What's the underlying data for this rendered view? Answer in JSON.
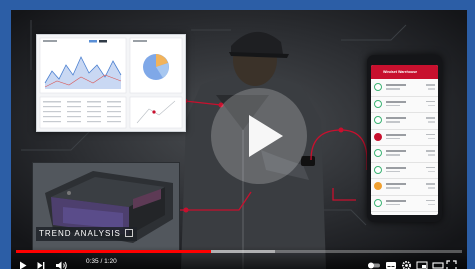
{
  "video": {
    "overlay_label": "TREND ANALYSIS",
    "phone_header": "Windset Warehouse",
    "time_current": "0:35",
    "time_separator": " / ",
    "time_total": "1:20",
    "played_fraction": 0.437,
    "loaded_fraction": 0.58
  },
  "colors": {
    "frame_bg": "#2c5ea6",
    "accent_red": "#c8102e",
    "progress_red": "#ff0000"
  },
  "controls": {
    "play": "play-icon",
    "next": "next-icon",
    "volume": "volume-icon",
    "autoplay": "autoplay-toggle-icon",
    "subtitles": "subtitles-icon",
    "settings": "gear-icon",
    "miniplayer": "miniplayer-icon",
    "theater": "theater-icon",
    "cast": "cast-icon",
    "fullscreen": "fullscreen-icon"
  },
  "phone_status_icons": [
    "check",
    "check",
    "check",
    "alert",
    "check",
    "check",
    "warn",
    "check",
    "check"
  ]
}
